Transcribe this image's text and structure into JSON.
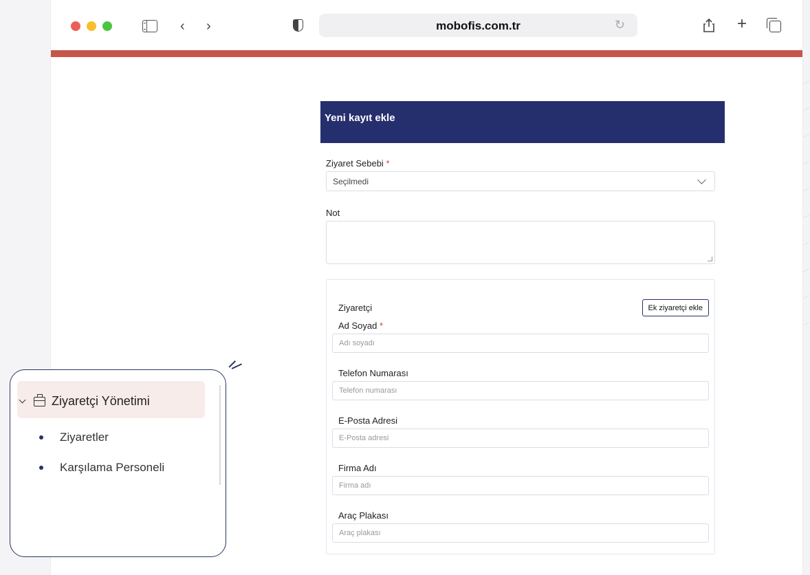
{
  "browser": {
    "url": "mobofis.com.tr"
  },
  "colors": {
    "accent_bar": "#c4564a",
    "header_bg": "#262f6e",
    "nav_active_bg": "#f8ecea"
  },
  "form": {
    "title": "Yeni kayıt ekle",
    "visit_reason": {
      "label": "Ziyaret Sebebi",
      "required_mark": "*",
      "value": "Seçilmedi"
    },
    "note": {
      "label": "Not"
    },
    "visitor": {
      "title": "Ziyaretçi",
      "add_button": "Ek ziyaretçi ekle",
      "fields": [
        {
          "label": "Ad Soyad",
          "required_mark": "*",
          "placeholder": "Adı soyadı"
        },
        {
          "label": "Telefon Numarası",
          "placeholder": "Telefon numarası"
        },
        {
          "label": "E-Posta Adresi",
          "placeholder": "E-Posta adresi"
        },
        {
          "label": "Firma Adı",
          "placeholder": "Firma adı"
        },
        {
          "label": "Araç Plakası",
          "placeholder": "Araç plakası"
        }
      ]
    }
  },
  "nav": {
    "group_label": "Ziyaretçi Yönetimi",
    "group_icon": "briefcase-icon",
    "items": [
      {
        "label": "Ziyaretler"
      },
      {
        "label": "Karşılama Personeli"
      }
    ]
  }
}
